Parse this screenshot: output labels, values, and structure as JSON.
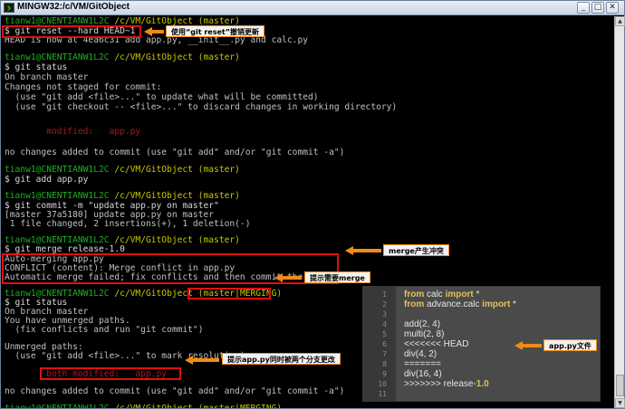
{
  "window": {
    "title": "MINGW32:/c/VM/GitObject",
    "buttons": {
      "minimize": "_",
      "maximize": "□",
      "close": "✕"
    }
  },
  "colors": {
    "prompt_user": "#1eb01e",
    "prompt_path": "#c8c800",
    "modified": "#b11818",
    "annotation_border": "#e01010",
    "annotation_arrow": "#f28a14"
  },
  "terminal": {
    "prompt": {
      "user": "tianw1@CNENTIANW1L2C",
      "path": "/c/VM/GitObject",
      "branch": "(master)",
      "branch_merging": "(master|MERGING)"
    },
    "lines": {
      "cmd_reset": "$ git reset --hard HEAD~1",
      "out_head": "HEAD is now at 4ea6c31 add app.py, __init__.py and calc.py",
      "cmd_status1": "$ git status",
      "out_onbranch1": "On branch master",
      "out_not_staged": "Changes not staged for commit:",
      "out_hint_add": "  (use \"git add <file>...\" to update what will be committed)",
      "out_hint_checkout": "  (use \"git checkout -- <file>...\" to discard changes in working directory)",
      "out_modified": "        modified:   app.py",
      "out_no_changes1": "no changes added to commit (use \"git add\" and/or \"git commit -a\")",
      "cmd_add": "$ git add app.py",
      "cmd_commit": "$ git commit -m \"update app.py on master\"",
      "out_commit": "[master 37a5180] update app.py on master",
      "out_changed": " 1 file changed, 2 insertions(+), 1 deletion(-)",
      "cmd_merge": "$ git merge release-1.0",
      "out_automerge": "Auto-merging app.py",
      "out_conflict": "CONFLICT (content): Merge conflict in app.py",
      "out_failed": "Automatic merge failed; fix conflicts and then commit the result.",
      "cmd_status2": "$ git status",
      "out_onbranch2": "On branch master",
      "out_unmerged": "You have unmerged paths.",
      "out_hint_fix": "  (fix conflicts and run \"git commit\")",
      "out_unmerged_paths": "Unmerged paths:",
      "out_hint_mark": "  (use \"git add <file>...\" to mark resolution)",
      "out_both_modified": "        both modified:   app.py",
      "out_no_changes2": "no changes added to commit (use \"git add\" and/or \"git commit -a\")",
      "cursor": "$"
    }
  },
  "annotations": {
    "reset": "使用“git reset”撤销更新",
    "merge_conflict": "merge产生冲突",
    "merging_hint": "提示需要merge",
    "both_modified_hint": "提示app.py同时被两个分支更改",
    "app_py_file": "app.py文件"
  },
  "code_panel": {
    "line_numbers": [
      "1",
      "2",
      "3",
      "4",
      "5",
      "6",
      "7",
      "8",
      "9",
      "10",
      "11"
    ],
    "line1": {
      "kw1": "from",
      "mod": " calc ",
      "kw2": "import",
      "rest": " *"
    },
    "line2": {
      "kw1": "from",
      "mod": " advance.calc ",
      "kw2": "import",
      "rest": " *"
    },
    "line4": "add(2, 4)",
    "line5": "multi(2, 8)",
    "line6": "<<<<<<< HEAD",
    "line7": "div(4, 2)",
    "line8": "=======",
    "line9": "div(16, 4)",
    "line10": {
      "prefix": ">>>>>>> release-",
      "num": "1.0"
    }
  }
}
